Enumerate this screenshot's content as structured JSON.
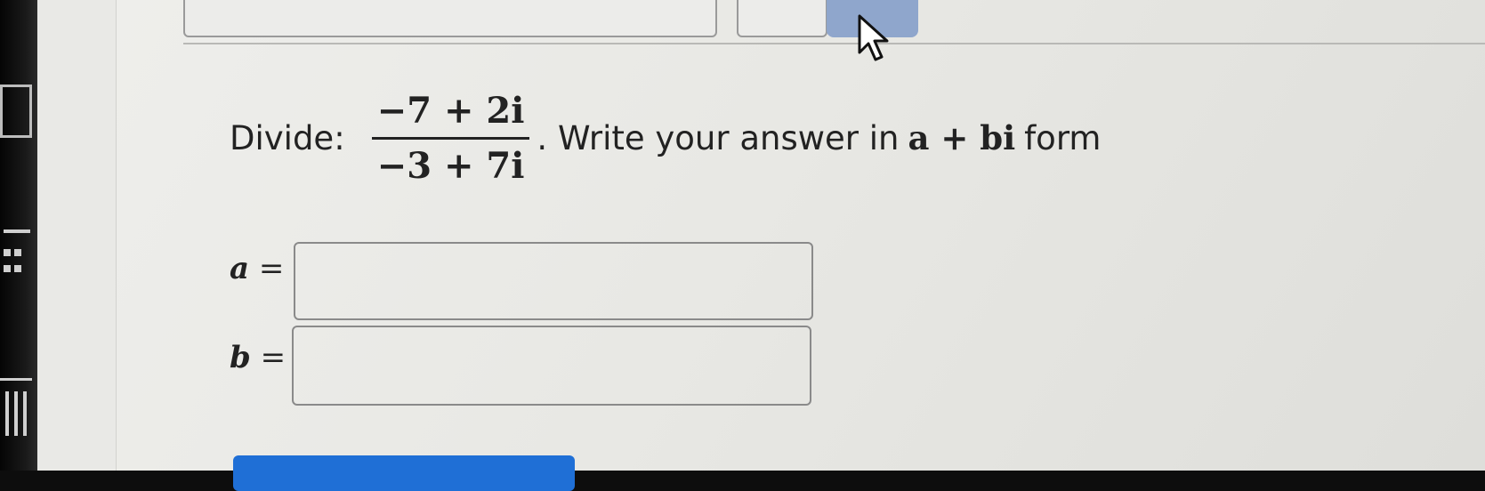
{
  "question": {
    "prefix": "Divide:",
    "numerator": "−7 + 2i",
    "denominator": "−3 + 7i",
    "suffix": ". Write your answer in",
    "form": "a + bi",
    "form_tail": "form"
  },
  "answers": {
    "a_label": "a",
    "b_label": "b",
    "equals": "=",
    "a_value": "",
    "b_value": ""
  },
  "colors": {
    "accent": "#1f6fd6",
    "active_tab": "#8fa6cc"
  },
  "icons": {
    "cursor": "mouse-pointer-icon"
  }
}
